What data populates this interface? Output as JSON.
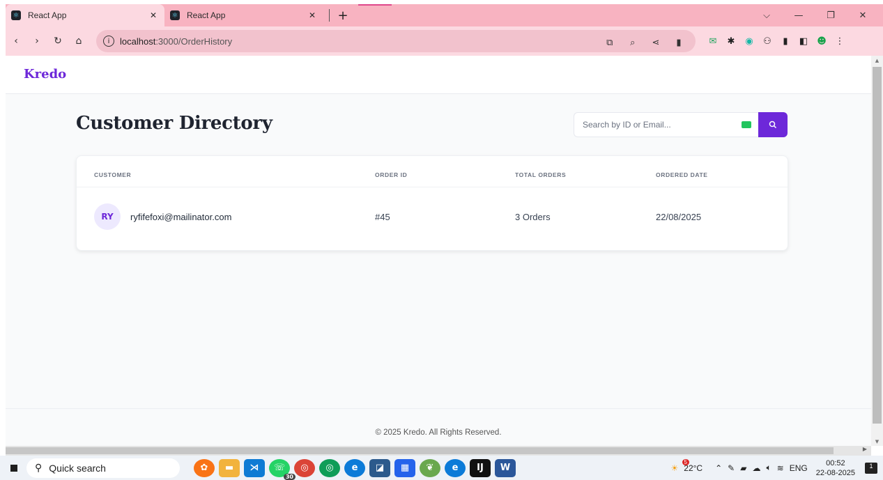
{
  "browser": {
    "tabs": [
      {
        "title": "React App",
        "active": true
      },
      {
        "title": "React App",
        "active": false
      }
    ],
    "new_tab": "+",
    "url_host": "localhost",
    "url_path": ":3000/OrderHistory",
    "window_controls": {
      "dropdown": "⌵",
      "minimize": "—",
      "restore": "❐",
      "close": "✕"
    }
  },
  "app": {
    "brand": "Kredo",
    "page_title": "Customer Directory",
    "search": {
      "placeholder": "Search by ID or Email..."
    },
    "table": {
      "headers": [
        "CUSTOMER",
        "ORDER ID",
        "TOTAL ORDERS",
        "ORDERED DATE"
      ],
      "rows": [
        {
          "initials": "RY",
          "email": "ryfifefoxi@mailinator.com",
          "order_id": "#45",
          "total_orders": "3 Orders",
          "date": "22/08/2025"
        }
      ]
    },
    "footer": "© 2025 Kredo. All Rights Reserved."
  },
  "taskbar": {
    "search_label": "Quick search",
    "whatsapp_badge": "30",
    "weather_badge": "5",
    "temperature": "22°C",
    "language": "ENG",
    "time": "00:52",
    "date": "22-08-2025",
    "notifications": "1"
  },
  "colors": {
    "accent": "#6d28d9",
    "tab_strip": "#f8b3c1",
    "toolbar": "#fcd9e1"
  }
}
